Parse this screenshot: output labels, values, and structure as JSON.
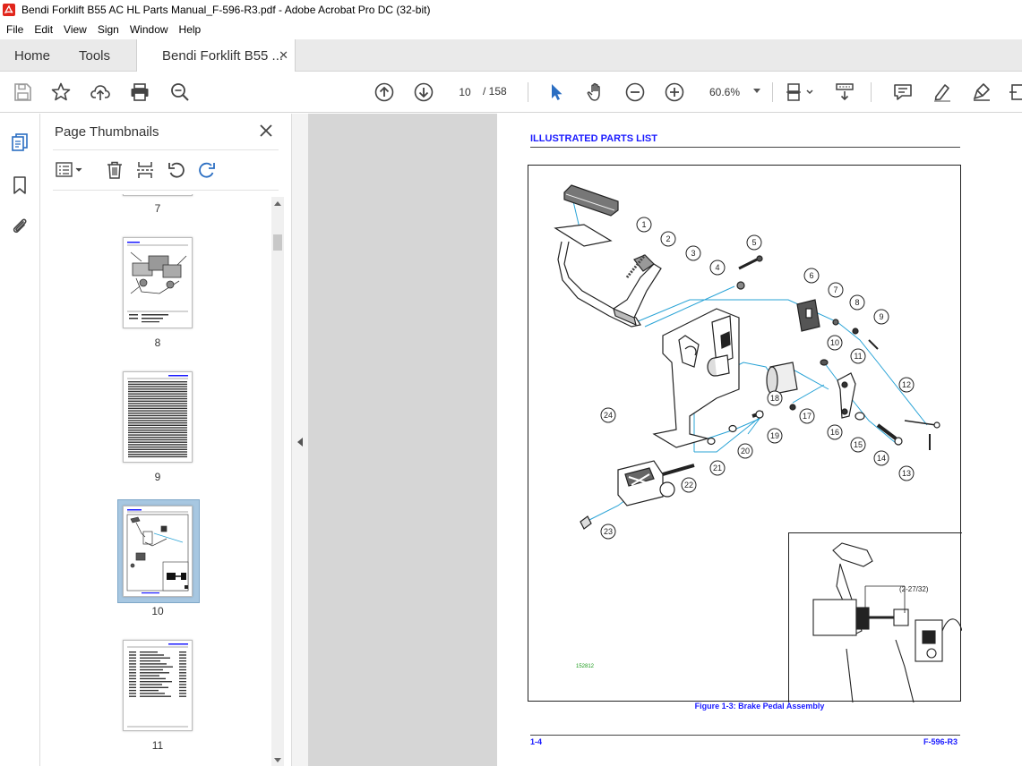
{
  "window": {
    "title": "Bendi Forklift B55 AC HL Parts Manual_F-596-R3.pdf - Adobe Acrobat Pro DC (32-bit)"
  },
  "menu": [
    "File",
    "Edit",
    "View",
    "Sign",
    "Window",
    "Help"
  ],
  "tabs": {
    "home": "Home",
    "tools": "Tools",
    "doc": "Bendi Forklift B55 ...",
    "doc_close": "✕"
  },
  "toolbar": {
    "page_current": "10",
    "page_total": "/ 158",
    "zoom": "60.6%"
  },
  "thumbnails_panel": {
    "title": "Page Thumbnails",
    "pages": [
      {
        "label": "7",
        "selected": false
      },
      {
        "label": "8",
        "selected": false
      },
      {
        "label": "9",
        "selected": false
      },
      {
        "label": "10",
        "selected": true
      },
      {
        "label": "11",
        "selected": false
      }
    ]
  },
  "document": {
    "header": "ILLUSTRATED PARTS LIST",
    "caption": "Figure 1-3:  Brake Pedal Assembly",
    "footer_left": "1-4",
    "footer_right": "F-596-R3",
    "drawing_code": "152812",
    "inset_dimension": "(2-27/32)",
    "callouts": [
      "1",
      "2",
      "3",
      "4",
      "5",
      "6",
      "7",
      "8",
      "9",
      "10",
      "11",
      "12",
      "13",
      "14",
      "15",
      "16",
      "17",
      "18",
      "19",
      "20",
      "21",
      "22",
      "23",
      "24"
    ],
    "accent_color": "#1a1aff",
    "leader_color": "#29a3d6"
  },
  "colors": {
    "acrobat_red": "#e1251b",
    "selection_blue": "#a7c7e1",
    "tool_blue": "#2b6ec2"
  }
}
